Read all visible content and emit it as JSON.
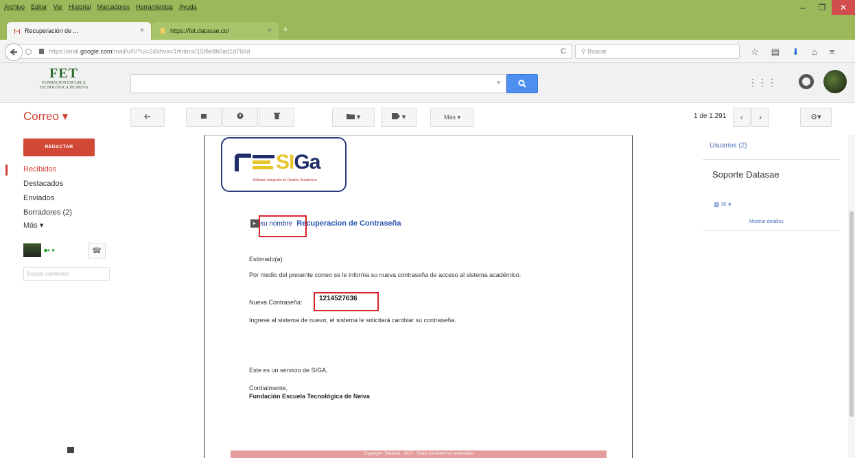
{
  "browser": {
    "menu": [
      "Archivo",
      "Editar",
      "Ver",
      "Historial",
      "Marcadores",
      "Herramientas",
      "Ayuda"
    ],
    "window_controls": [
      "–",
      "❐",
      "✕"
    ],
    "tabs": [
      {
        "label": "Recuperación de ...",
        "icon": "gmail-icon"
      },
      {
        "label": "https://fet.datasae.co/",
        "icon": "page-icon"
      }
    ],
    "tab_close": "×",
    "new_tab": "+",
    "url_prefix": "https://mail.",
    "url_domain": "google.com",
    "url_rest": "/mail/u/0/?ui=2&shva=1#inbox/15f8e8b0ad1d766d",
    "search_placeholder": "Buscar",
    "reload": "C"
  },
  "gmail_header": {
    "logo_title": "FET",
    "logo_sub1": "FUNDACIÓN ESCUELA",
    "logo_sub2": "TECNOLÓGICA DE NEIVA",
    "search_value": "",
    "dropdown": "▾"
  },
  "toolbar": {
    "app_label": "Correo ▾",
    "more_label": "Más ▾",
    "pager": "1 de 1.291"
  },
  "leftnav": {
    "compose": "REDACTAR",
    "items": [
      "Recibidos",
      "Destacados",
      "Enviados",
      "Borradores (2)",
      "Más ▾"
    ],
    "contact_search_placeholder": "Buscar contactos"
  },
  "email": {
    "logo_word_a": "SI",
    "logo_word_b": "Ga",
    "logo_tagline": "Software Integrado de Gestión Académica",
    "arrow": "▸",
    "highlight_name": "su nombre",
    "headline": "Recuperacion de Contraseña",
    "greeting": "Estimado(a)",
    "body1": "Por medio del presente correo se le informa su nueva contraseña de acceso al sistema académico.",
    "pwd_label": "Nueva Contraseña:",
    "pwd_value": "1214527636",
    "instruction": "Ingrese al sistema de nuevo, el sistema le solicitará cambiar su contraseña.",
    "service": "Este es un servicio de SIGA.",
    "closing": "Cordialmente,",
    "signature": "Fundación Escuela Tecnológica de Neiva",
    "footer": "Copyright · Datasae · 2017 · Todos los derechos reservados"
  },
  "sidebar": {
    "users": "Usuarios (2)",
    "contact_name": "Soporte Datasae",
    "details_link": "Mostrar detalles"
  },
  "colors": {
    "browser_green": "#9bb85a",
    "gmail_red": "#d14836",
    "search_blue": "#4d8ff0",
    "highlight_red": "#d8232a",
    "siga_navy": "#1f2d6a",
    "siga_yellow": "#e6c42a"
  }
}
